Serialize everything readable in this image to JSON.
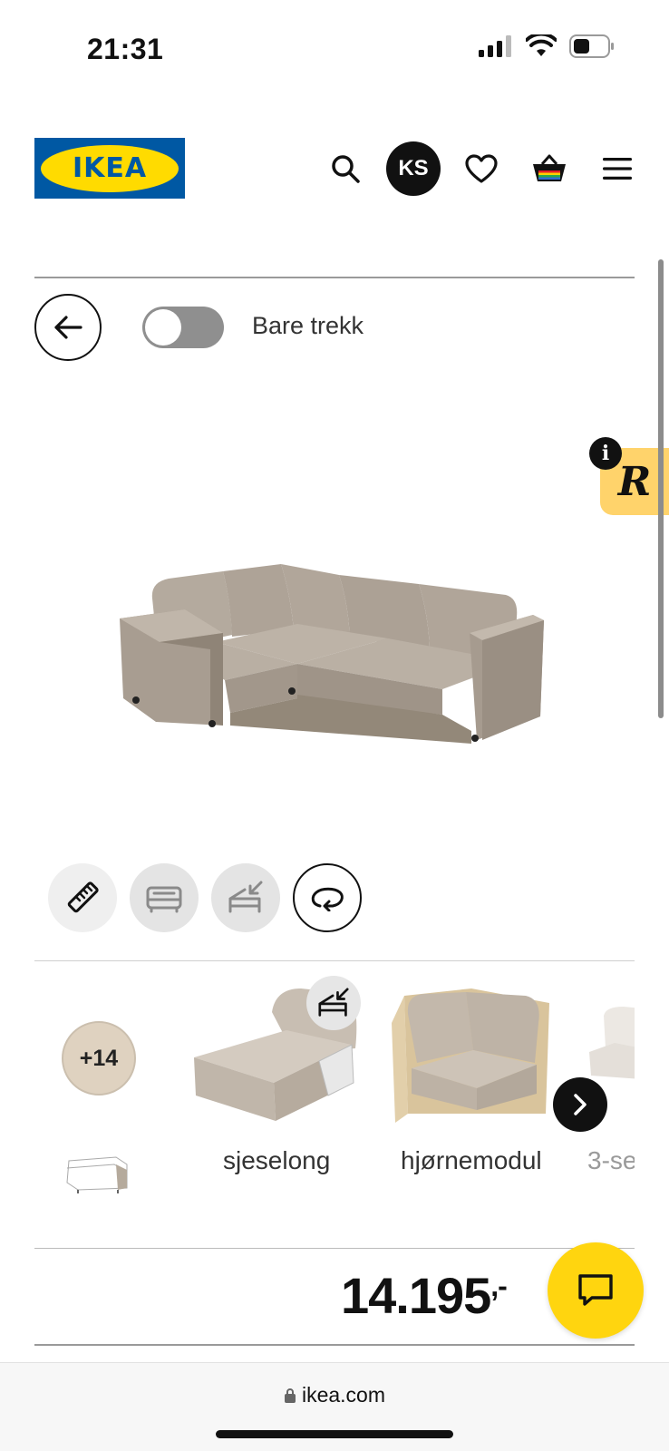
{
  "status_bar": {
    "time": "21:31"
  },
  "header": {
    "logo_text": "IKEA",
    "avatar_initials": "KS",
    "icons": [
      "search-icon",
      "heart-icon",
      "basket-icon",
      "menu-icon"
    ]
  },
  "controls": {
    "toggle_label": "Bare trekk",
    "toggle_on": false
  },
  "widget": {
    "letter": "R",
    "info": "i"
  },
  "tools": [
    "ruler-icon",
    "bed-icon",
    "module-add-icon",
    "rotate-icon"
  ],
  "modules": {
    "more_count": "+14",
    "items": [
      {
        "label": "sjeselong"
      },
      {
        "label": "hjørnemodul"
      },
      {
        "label": "3-se"
      }
    ]
  },
  "price": {
    "amount": "14.195",
    "suffix": ",-"
  },
  "browser": {
    "url": "ikea.com"
  },
  "colors": {
    "ikea_blue": "#0058a3",
    "ikea_yellow": "#ffdb00",
    "chat_yellow": "#ffd50f",
    "widget_yellow": "#ffd36b",
    "fabric_beige": "#a79c90"
  }
}
